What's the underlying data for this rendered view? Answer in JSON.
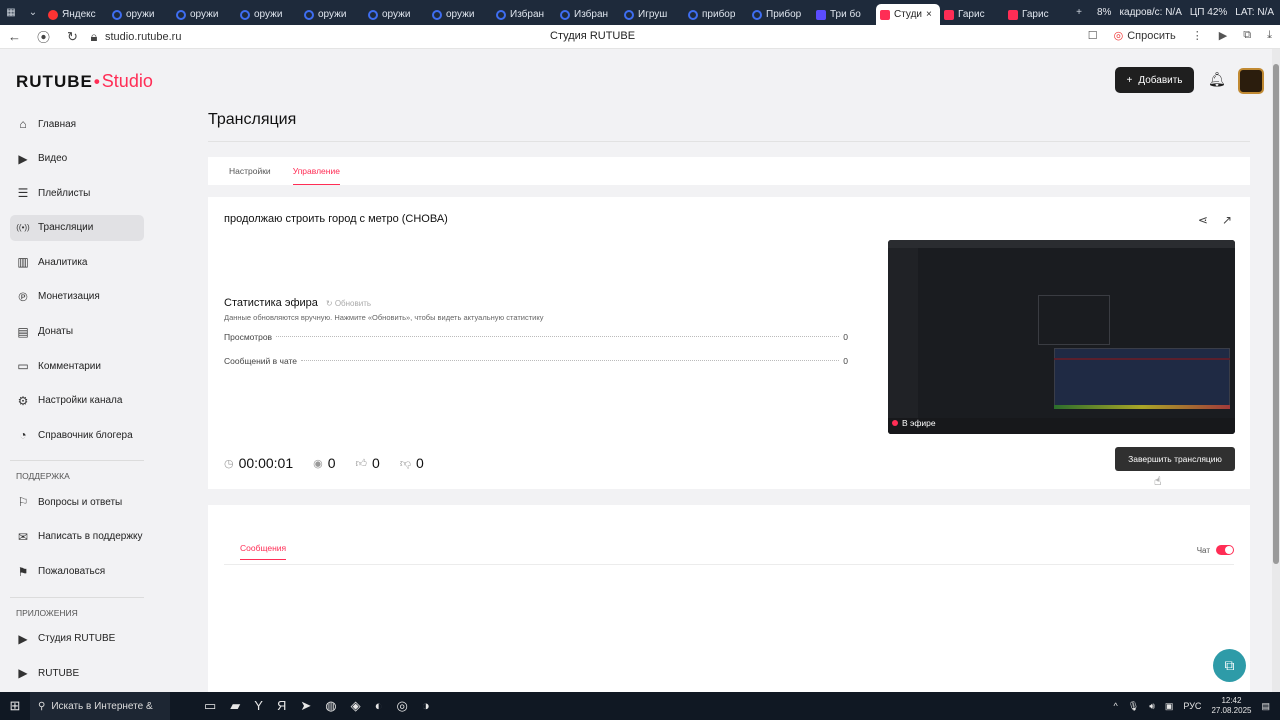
{
  "browser": {
    "tabs": [
      {
        "label": "Яндекс",
        "icon": "yandex-icon"
      },
      {
        "label": "оружи",
        "icon": "edge-icon"
      },
      {
        "label": "оружи",
        "icon": "edge-icon"
      },
      {
        "label": "оружи",
        "icon": "edge-icon"
      },
      {
        "label": "оружи",
        "icon": "edge-icon"
      },
      {
        "label": "оружи",
        "icon": "edge-icon"
      },
      {
        "label": "оружи",
        "icon": "edge-icon"
      },
      {
        "label": "Избран",
        "icon": "edge-icon"
      },
      {
        "label": "Избран",
        "icon": "edge-icon"
      },
      {
        "label": "Игруш",
        "icon": "edge-icon"
      },
      {
        "label": "прибор",
        "icon": "edge-icon"
      },
      {
        "label": "Прибор",
        "icon": "edge-icon"
      },
      {
        "label": "Три бо",
        "icon": "kinopoisk-icon"
      },
      {
        "label": "Студи",
        "icon": "rutube-icon",
        "active": true
      },
      {
        "label": "Гарис",
        "icon": "rutube-icon"
      },
      {
        "label": "Гарис",
        "icon": "rutube-icon"
      }
    ],
    "tray_cpu": "8%",
    "tray_cp": "ЦП 42%",
    "tray_lat": "LAT: N/A",
    "tray_kadr": "кадров/с: N/A",
    "url": "studio.rutube.ru",
    "page_title": "Студия RUTUBE",
    "ask_label": "Спросить"
  },
  "app": {
    "logo_main": "RUTUBE",
    "logo_studio": "Studio",
    "add_label": "Добавить",
    "page_title": "Трансляция"
  },
  "sidebar": {
    "items": [
      {
        "label": "Главная",
        "icon": "home-icon"
      },
      {
        "label": "Видео",
        "icon": "video-icon"
      },
      {
        "label": "Плейлисты",
        "icon": "playlist-icon"
      },
      {
        "label": "Трансляции",
        "icon": "broadcast-icon",
        "active": true
      },
      {
        "label": "Аналитика",
        "icon": "analytics-icon"
      },
      {
        "label": "Монетизация",
        "icon": "monetization-icon"
      },
      {
        "label": "Донаты",
        "icon": "donate-icon"
      },
      {
        "label": "Комментарии",
        "icon": "comments-icon"
      },
      {
        "label": "Настройки канала",
        "icon": "settings-icon"
      },
      {
        "label": "Справочник блогера",
        "icon": "help-icon"
      }
    ],
    "support_heading": "ПОДДЕРЖКА",
    "support_items": [
      {
        "label": "Вопросы и ответы",
        "icon": "faq-icon"
      },
      {
        "label": "Написать в поддержку",
        "icon": "mail-icon"
      },
      {
        "label": "Пожаловаться",
        "icon": "flag-icon"
      }
    ],
    "apps_heading": "ПРИЛОЖЕНИЯ",
    "apps_items": [
      {
        "label": "Студия RUTUBE",
        "icon": "studio-icon"
      },
      {
        "label": "RUTUBE",
        "icon": "rutube-icon"
      }
    ]
  },
  "tabs": {
    "settings": "Настройки",
    "manage": "Управление"
  },
  "stream": {
    "title": "продолжаю строить город с метро (СНОВА)",
    "stats_title": "Статистика эфира",
    "refresh": "Обновить",
    "note": "Данные обновляются вручную. Нажмите «Обновить», чтобы видеть актуальную статистику",
    "views_label": "Просмотров",
    "views_value": "0",
    "chat_label": "Сообщений в чате",
    "chat_value": "0",
    "live_label": "В эфире",
    "duration": "00:00:01",
    "viewers": "0",
    "likes": "0",
    "dislikes": "0",
    "end_label": "Завершить трансляцию"
  },
  "chat": {
    "tab": "Сообщения",
    "toggle_label": "Чат",
    "enabled": true
  },
  "taskbar": {
    "search": "Искать в Интернете &",
    "lang": "РУС",
    "time": "12:42",
    "date": "27.08.2025"
  }
}
